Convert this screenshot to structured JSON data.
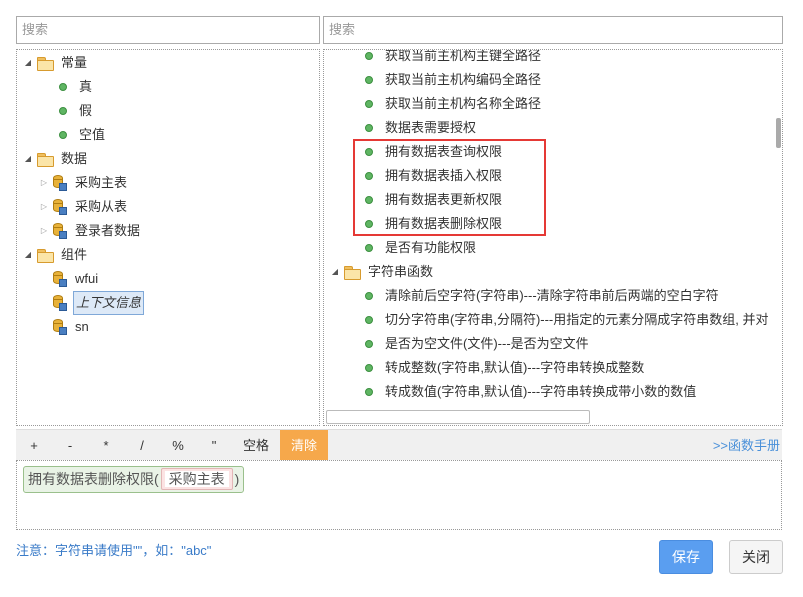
{
  "search": {
    "left_placeholder": "搜索",
    "right_placeholder": "搜索"
  },
  "left_tree": {
    "constants": {
      "label": "常量",
      "items": [
        "真",
        "假",
        "空值"
      ]
    },
    "data": {
      "label": "数据",
      "items": [
        "采购主表",
        "采购从表",
        "登录者数据"
      ]
    },
    "components": {
      "label": "组件",
      "items": [
        "wfui",
        "上下文信息",
        "sn"
      ]
    }
  },
  "right_tree": {
    "items_top": [
      "获取当前主机构主键全路径",
      "获取当前主机构编码全路径",
      "获取当前主机构名称全路径",
      "数据表需要授权",
      "拥有数据表查询权限",
      "拥有数据表插入权限",
      "拥有数据表更新权限",
      "拥有数据表删除权限",
      "是否有功能权限"
    ],
    "string_group": {
      "label": "字符串函数",
      "items": [
        "清除前后空字符(字符串)---清除字符串前后两端的空白字符",
        "切分字符串(字符串,分隔符)---用指定的元素分隔成字符串数组, 并对",
        "是否为空文件(文件)---是否为空文件",
        "转成整数(字符串,默认值)---字符串转换成整数",
        "转成数值(字符串,默认值)---字符串转换成带小数的数值"
      ]
    }
  },
  "operators": [
    "+",
    "-",
    "*",
    "/",
    "%",
    "\"",
    "空格"
  ],
  "clear_label": "清除",
  "manual_link": ">>函数手册",
  "expression": {
    "func": "拥有数据表删除权限(",
    "arg": "采购主表",
    "close": ")"
  },
  "note": "注意：字符串请使用\"\"，如：\"abc\"",
  "buttons": {
    "save": "保存",
    "close": "关闭"
  },
  "colors": {
    "accent": "#5a9ef0",
    "clear": "#f6a84b",
    "highlight": "#e53935",
    "link": "#4a90d9"
  }
}
